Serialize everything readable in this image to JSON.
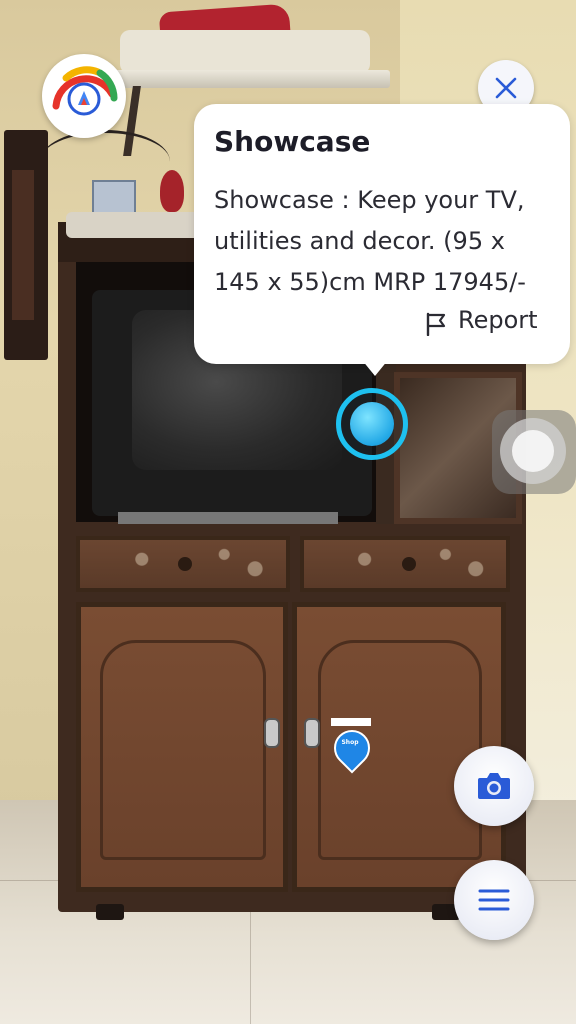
{
  "card": {
    "title": "Showcase",
    "description": "Showcase : Keep your TV, utilities and decor. (95 x 145 x 55)cm  MRP 17945/-",
    "report_label": "Report"
  },
  "pin": {
    "label": "Shop"
  },
  "colors": {
    "accent": "#1ec1f0",
    "icon_blue": "#2a5bd7",
    "card_bg": "#ffffff"
  },
  "icons": {
    "close": "close-icon",
    "gauge": "gauge-icon",
    "camera": "camera-icon",
    "menu": "hamburger-menu-icon",
    "report": "flag-icon"
  }
}
